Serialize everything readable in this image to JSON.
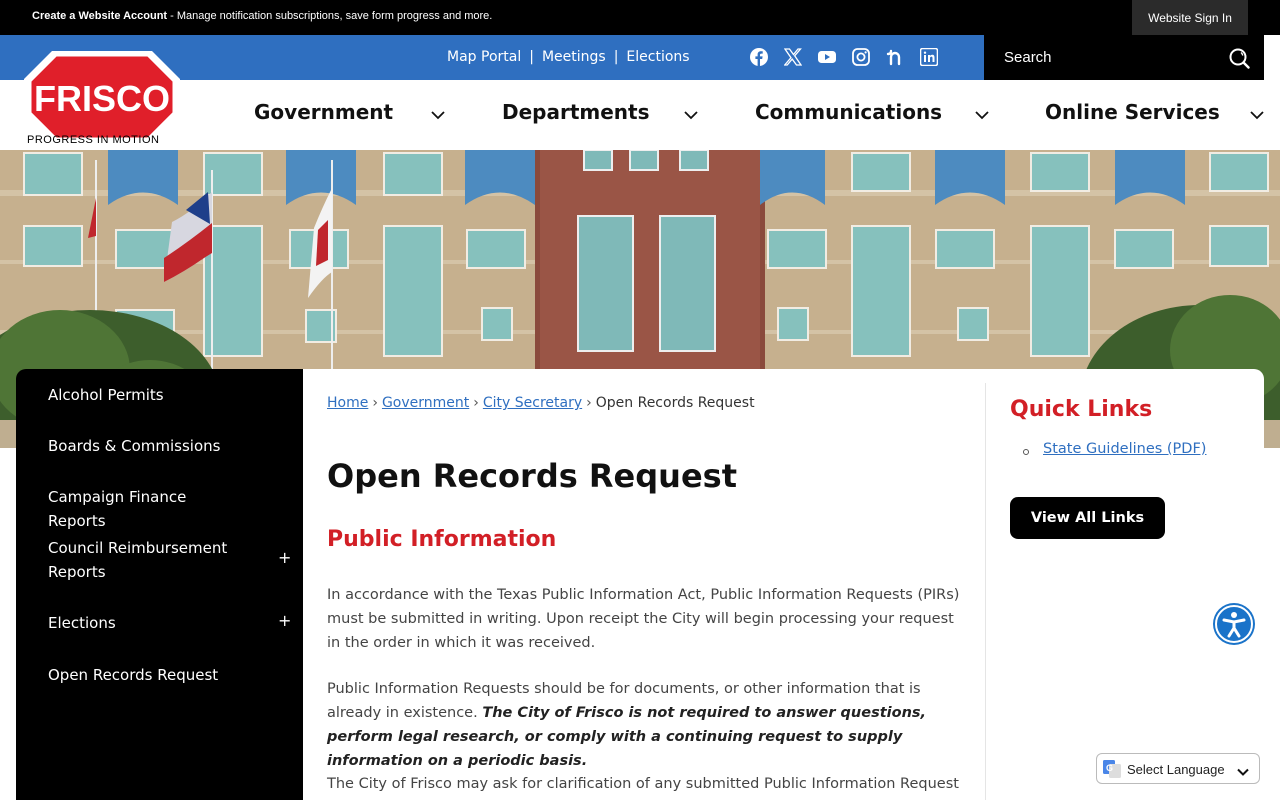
{
  "topbar": {
    "promo_bold": "Create a Website Account",
    "promo_rest": " - Manage notification subscriptions, save form progress and more.",
    "signin_label": "Website Sign In"
  },
  "utility": {
    "links": [
      "Map Portal",
      "Meetings",
      "Elections"
    ],
    "social_icons": [
      "facebook-icon",
      "x-twitter-icon",
      "youtube-icon",
      "instagram-icon",
      "nextdoor-icon",
      "linkedin-icon"
    ],
    "search_placeholder": "Search"
  },
  "logo": {
    "wordmark": "FRISCO",
    "tagline": "PROGRESS IN MOTION"
  },
  "nav": [
    "Government",
    "Departments",
    "Communications",
    "Online Services"
  ],
  "sidenav": {
    "items": [
      {
        "label": "Alcohol Permits"
      },
      {
        "label": "Boards & Commissions"
      },
      {
        "label": "Campaign Finance Reports"
      },
      {
        "label": "Council Reimbursement Reports",
        "expand": "+"
      },
      {
        "label": "Elections",
        "expand": "+"
      },
      {
        "label": "Open Records Request"
      }
    ]
  },
  "breadcrumb": {
    "items": [
      "Home",
      "Government",
      "City Secretary"
    ],
    "current": "Open Records Request"
  },
  "page": {
    "title": "Open Records Request",
    "subtitle": "Public Information",
    "para1": "In accordance with the Texas Public Information Act, Public Information Requests (PIRs) must be submitted in writing. Upon receipt the City will begin processing your request in the order in which it was received.",
    "para2_plain": "Public Information Requests should be for documents, or other information that is already in existence. ",
    "para2_em": "The City of Frisco is not required to answer questions, perform legal research, or comply with a continuing request to supply information on a periodic basis.",
    "para3": "The City of Frisco may ask for clarification of any submitted Public Information Request if it is"
  },
  "quick_links": {
    "title": "Quick Links",
    "items": [
      "State Guidelines (PDF)"
    ],
    "view_all": "View All Links"
  },
  "translate": {
    "label": "Select Language"
  },
  "colors": {
    "brand_red": "#d21f26",
    "util_blue": "#2f6fc0",
    "link_blue": "#2f6fc0"
  }
}
